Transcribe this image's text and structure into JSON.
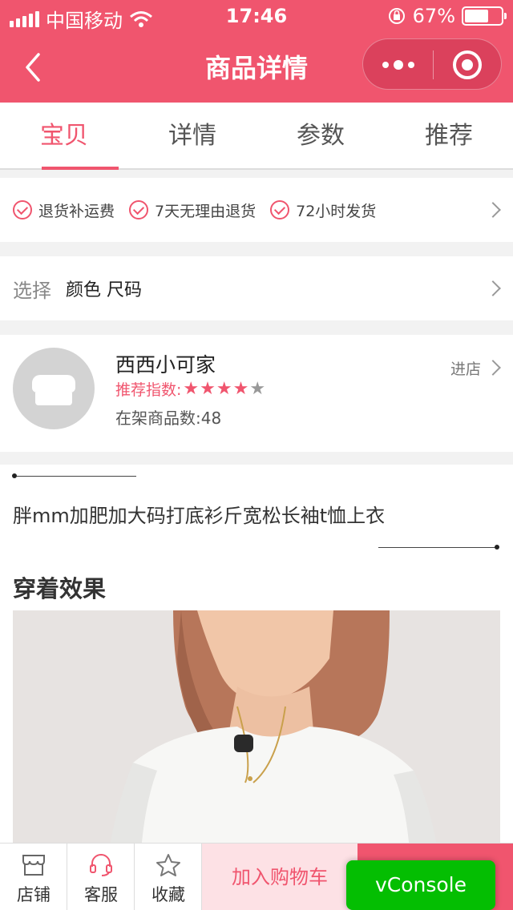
{
  "status_bar": {
    "carrier": "中国移动",
    "time": "17:46",
    "battery_percent": "67%",
    "battery_level": 0.67,
    "icons": [
      "signal-icon",
      "wifi-icon",
      "rotation-lock-icon",
      "battery-icon"
    ]
  },
  "nav": {
    "title": "商品详情",
    "back_icon": "chevron-left-icon",
    "menu_icon": "more-dots-icon",
    "close_icon": "target-circle-icon"
  },
  "tabs": [
    {
      "label": "宝贝",
      "active": true
    },
    {
      "label": "详情",
      "active": false
    },
    {
      "label": "参数",
      "active": false
    },
    {
      "label": "推荐",
      "active": false
    }
  ],
  "services": [
    "退货补运费",
    "7天无理由退货",
    "72小时发货"
  ],
  "select": {
    "label": "选择",
    "options": "颜色 尺码"
  },
  "shop": {
    "name": "西西小可家",
    "rating_label": "推荐指数:",
    "rating": 4,
    "rating_max": 5,
    "count_label": "在架商品数:",
    "count": "48",
    "enter_label": "进店"
  },
  "product": {
    "title": "胖mm加肥加大码打底衫斤宽松长袖t恤上衣",
    "section_title": "穿着效果"
  },
  "bottom_bar": {
    "shop_label": "店铺",
    "service_label": "客服",
    "favorite_label": "收藏",
    "add_cart_label": "加入购物车"
  },
  "vconsole": "vConsole",
  "colors": {
    "brand": "#f0556e",
    "vconsole": "#04be02"
  }
}
